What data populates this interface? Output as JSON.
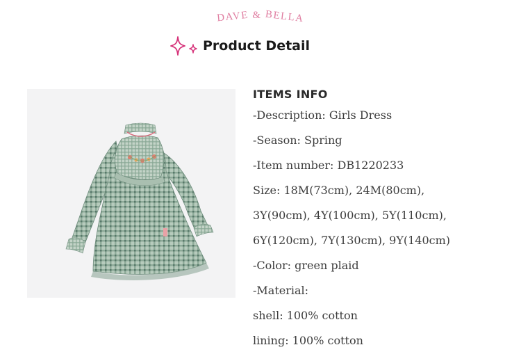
{
  "brand": {
    "part1": "DAVE",
    "part2": "&",
    "part3": "BELLA"
  },
  "header": {
    "title": "Product Detail"
  },
  "product_image": {
    "alt": "Girls green plaid long-sleeve dress with ruffled bib collar"
  },
  "info": {
    "heading": "ITEMS INFO",
    "lines": [
      "-Description: Girls Dress",
      "-Season: Spring",
      "-Item number: DB1220233",
      "Size: 18M(73cm), 24M(80cm),",
      "3Y(90cm), 4Y(100cm), 5Y(110cm),",
      "6Y(120cm), 7Y(130cm), 9Y(140cm)",
      "-Color: green plaid",
      "-Material:",
      "shell: 100% cotton",
      "lining: 100% cotton"
    ]
  },
  "colors": {
    "brand_pink": "#e07fa2",
    "sparkle_magenta": "#d6337a",
    "text": "#3c3c3c"
  },
  "icons": [
    "sparkle-icon"
  ]
}
